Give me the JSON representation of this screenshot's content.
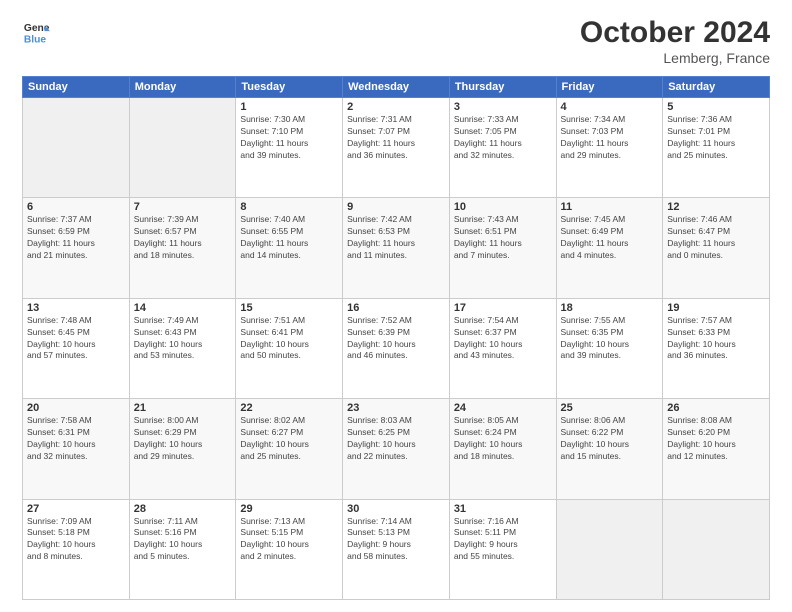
{
  "header": {
    "logo_line1": "General",
    "logo_line2": "Blue",
    "month": "October 2024",
    "location": "Lemberg, France"
  },
  "weekdays": [
    "Sunday",
    "Monday",
    "Tuesday",
    "Wednesday",
    "Thursday",
    "Friday",
    "Saturday"
  ],
  "weeks": [
    [
      {
        "day": "",
        "info": ""
      },
      {
        "day": "",
        "info": ""
      },
      {
        "day": "1",
        "info": "Sunrise: 7:30 AM\nSunset: 7:10 PM\nDaylight: 11 hours\nand 39 minutes."
      },
      {
        "day": "2",
        "info": "Sunrise: 7:31 AM\nSunset: 7:07 PM\nDaylight: 11 hours\nand 36 minutes."
      },
      {
        "day": "3",
        "info": "Sunrise: 7:33 AM\nSunset: 7:05 PM\nDaylight: 11 hours\nand 32 minutes."
      },
      {
        "day": "4",
        "info": "Sunrise: 7:34 AM\nSunset: 7:03 PM\nDaylight: 11 hours\nand 29 minutes."
      },
      {
        "day": "5",
        "info": "Sunrise: 7:36 AM\nSunset: 7:01 PM\nDaylight: 11 hours\nand 25 minutes."
      }
    ],
    [
      {
        "day": "6",
        "info": "Sunrise: 7:37 AM\nSunset: 6:59 PM\nDaylight: 11 hours\nand 21 minutes."
      },
      {
        "day": "7",
        "info": "Sunrise: 7:39 AM\nSunset: 6:57 PM\nDaylight: 11 hours\nand 18 minutes."
      },
      {
        "day": "8",
        "info": "Sunrise: 7:40 AM\nSunset: 6:55 PM\nDaylight: 11 hours\nand 14 minutes."
      },
      {
        "day": "9",
        "info": "Sunrise: 7:42 AM\nSunset: 6:53 PM\nDaylight: 11 hours\nand 11 minutes."
      },
      {
        "day": "10",
        "info": "Sunrise: 7:43 AM\nSunset: 6:51 PM\nDaylight: 11 hours\nand 7 minutes."
      },
      {
        "day": "11",
        "info": "Sunrise: 7:45 AM\nSunset: 6:49 PM\nDaylight: 11 hours\nand 4 minutes."
      },
      {
        "day": "12",
        "info": "Sunrise: 7:46 AM\nSunset: 6:47 PM\nDaylight: 11 hours\nand 0 minutes."
      }
    ],
    [
      {
        "day": "13",
        "info": "Sunrise: 7:48 AM\nSunset: 6:45 PM\nDaylight: 10 hours\nand 57 minutes."
      },
      {
        "day": "14",
        "info": "Sunrise: 7:49 AM\nSunset: 6:43 PM\nDaylight: 10 hours\nand 53 minutes."
      },
      {
        "day": "15",
        "info": "Sunrise: 7:51 AM\nSunset: 6:41 PM\nDaylight: 10 hours\nand 50 minutes."
      },
      {
        "day": "16",
        "info": "Sunrise: 7:52 AM\nSunset: 6:39 PM\nDaylight: 10 hours\nand 46 minutes."
      },
      {
        "day": "17",
        "info": "Sunrise: 7:54 AM\nSunset: 6:37 PM\nDaylight: 10 hours\nand 43 minutes."
      },
      {
        "day": "18",
        "info": "Sunrise: 7:55 AM\nSunset: 6:35 PM\nDaylight: 10 hours\nand 39 minutes."
      },
      {
        "day": "19",
        "info": "Sunrise: 7:57 AM\nSunset: 6:33 PM\nDaylight: 10 hours\nand 36 minutes."
      }
    ],
    [
      {
        "day": "20",
        "info": "Sunrise: 7:58 AM\nSunset: 6:31 PM\nDaylight: 10 hours\nand 32 minutes."
      },
      {
        "day": "21",
        "info": "Sunrise: 8:00 AM\nSunset: 6:29 PM\nDaylight: 10 hours\nand 29 minutes."
      },
      {
        "day": "22",
        "info": "Sunrise: 8:02 AM\nSunset: 6:27 PM\nDaylight: 10 hours\nand 25 minutes."
      },
      {
        "day": "23",
        "info": "Sunrise: 8:03 AM\nSunset: 6:25 PM\nDaylight: 10 hours\nand 22 minutes."
      },
      {
        "day": "24",
        "info": "Sunrise: 8:05 AM\nSunset: 6:24 PM\nDaylight: 10 hours\nand 18 minutes."
      },
      {
        "day": "25",
        "info": "Sunrise: 8:06 AM\nSunset: 6:22 PM\nDaylight: 10 hours\nand 15 minutes."
      },
      {
        "day": "26",
        "info": "Sunrise: 8:08 AM\nSunset: 6:20 PM\nDaylight: 10 hours\nand 12 minutes."
      }
    ],
    [
      {
        "day": "27",
        "info": "Sunrise: 7:09 AM\nSunset: 5:18 PM\nDaylight: 10 hours\nand 8 minutes."
      },
      {
        "day": "28",
        "info": "Sunrise: 7:11 AM\nSunset: 5:16 PM\nDaylight: 10 hours\nand 5 minutes."
      },
      {
        "day": "29",
        "info": "Sunrise: 7:13 AM\nSunset: 5:15 PM\nDaylight: 10 hours\nand 2 minutes."
      },
      {
        "day": "30",
        "info": "Sunrise: 7:14 AM\nSunset: 5:13 PM\nDaylight: 9 hours\nand 58 minutes."
      },
      {
        "day": "31",
        "info": "Sunrise: 7:16 AM\nSunset: 5:11 PM\nDaylight: 9 hours\nand 55 minutes."
      },
      {
        "day": "",
        "info": ""
      },
      {
        "day": "",
        "info": ""
      }
    ]
  ]
}
